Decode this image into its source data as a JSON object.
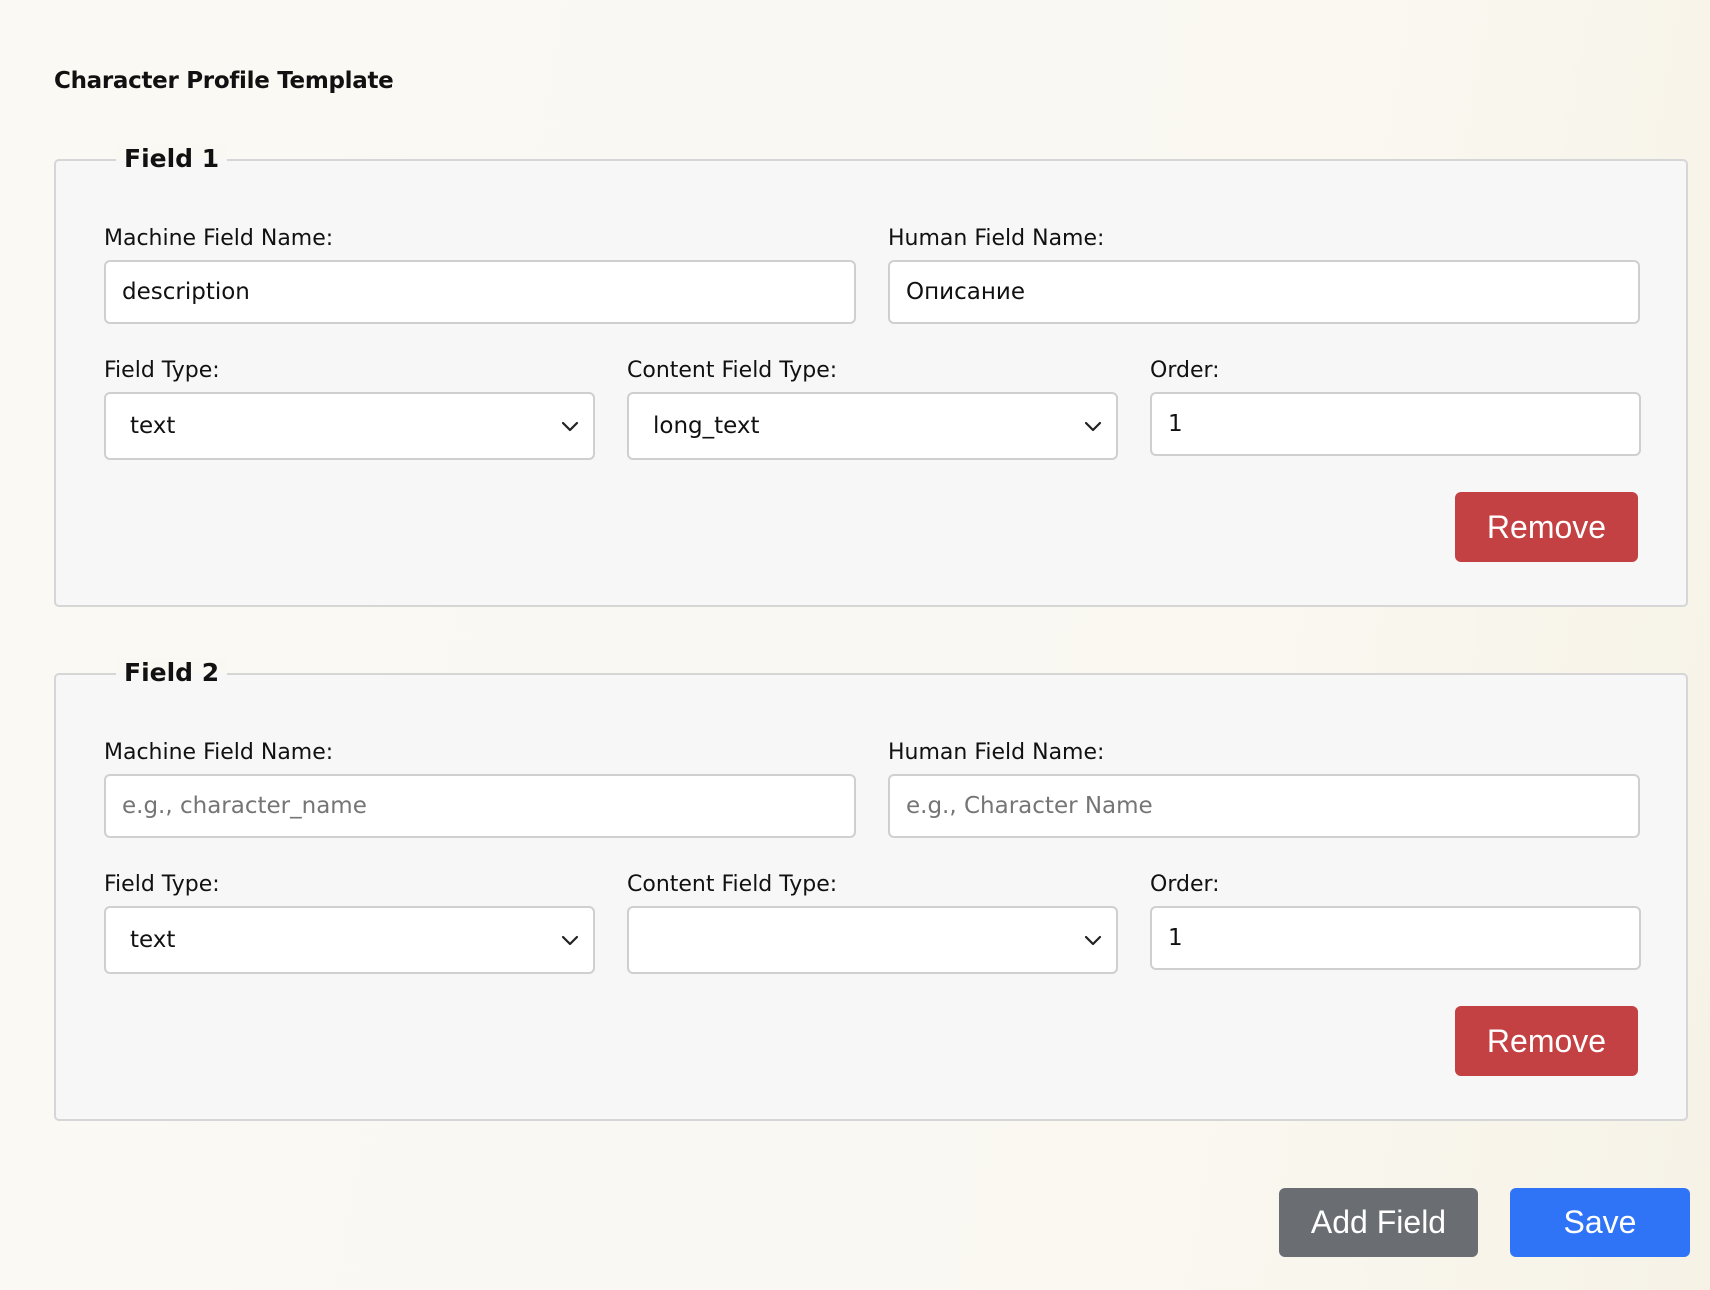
{
  "page": {
    "title": "Character Profile Template"
  },
  "labels": {
    "machine_field_name": "Machine Field Name:",
    "human_field_name": "Human Field Name:",
    "field_type": "Field Type:",
    "content_field_type": "Content Field Type:",
    "order": "Order:"
  },
  "fields": [
    {
      "legend": "Field 1",
      "machine_name": {
        "value": "description",
        "placeholder": ""
      },
      "human_name": {
        "value": "Описание",
        "placeholder": ""
      },
      "field_type": "text",
      "content_field_type": "long_text",
      "order": "1",
      "remove_label": "Remove"
    },
    {
      "legend": "Field 2",
      "machine_name": {
        "value": "",
        "placeholder": "e.g., character_name"
      },
      "human_name": {
        "value": "",
        "placeholder": "e.g., Character Name"
      },
      "field_type": "text",
      "content_field_type": "",
      "order": "1",
      "remove_label": "Remove"
    }
  ],
  "actions": {
    "add_field_label": "Add Field",
    "save_label": "Save"
  },
  "colors": {
    "remove_button": "#c44143",
    "add_field_button": "#6a6e73",
    "save_button": "#2f73f6"
  },
  "icons": {
    "select_chevron": "chevron-down-icon"
  }
}
